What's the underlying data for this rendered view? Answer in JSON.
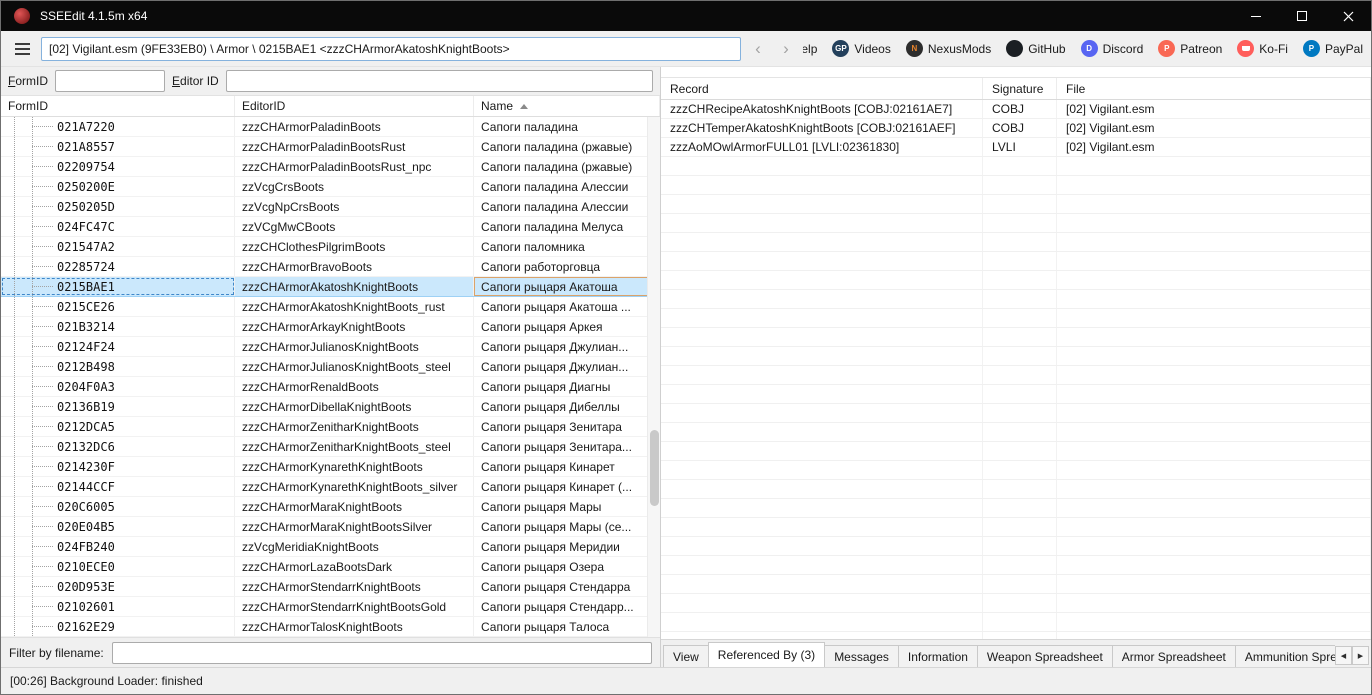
{
  "window": {
    "title": "SSEEdit 4.1.5m x64"
  },
  "toolbar": {
    "breadcrumb": "[02] Vigilant.esm (9FE33EB0) \\ Armor \\ 0215BAE1 <zzzCHArmorAkatoshKnightBoots>",
    "nav_back": "‹",
    "nav_forward": "›",
    "links": [
      {
        "label": "Help",
        "icon": "help-book-icon",
        "glyph": "book",
        "color": "#c89b5a"
      },
      {
        "label": "Videos",
        "icon": "videos-icon",
        "glyph": "GP",
        "color": "#23405c"
      },
      {
        "label": "NexusMods",
        "icon": "nexusmods-icon",
        "glyph": "N",
        "color": "#2d2d2d",
        "glyph_color": "#e6832c"
      },
      {
        "label": "GitHub",
        "icon": "github-icon",
        "glyph": "",
        "color": "#1b1f23"
      },
      {
        "label": "Discord",
        "icon": "discord-icon",
        "glyph": "D",
        "color": "#5865f2"
      },
      {
        "label": "Patreon",
        "icon": "patreon-icon",
        "glyph": "P",
        "color": "#f96854"
      },
      {
        "label": "Ko-Fi",
        "icon": "kofi-icon",
        "glyph": "cup",
        "color": "#ff5e5b"
      },
      {
        "label": "PayPal",
        "icon": "paypal-icon",
        "glyph": "P",
        "color": "#0079c1"
      }
    ]
  },
  "left_panel": {
    "formid_filter_label": "FormID",
    "formid_filter_value": "",
    "editorid_filter_label": "Editor ID",
    "editorid_filter_value": "",
    "columns": [
      "FormID",
      "EditorID",
      "Name"
    ],
    "sort_column": "Name",
    "filename_filter_label": "Filter by filename:",
    "filename_filter_value": "",
    "rows": [
      {
        "formid": "021A7220",
        "editorid": "zzzCHArmorPaladinBoots",
        "name": "Сапоги паладина",
        "selected": false
      },
      {
        "formid": "021A8557",
        "editorid": "zzzCHArmorPaladinBootsRust",
        "name": "Сапоги паладина (ржавые)",
        "selected": false
      },
      {
        "formid": "02209754",
        "editorid": "zzzCHArmorPaladinBootsRust_npc",
        "name": "Сапоги паладина (ржавые)",
        "selected": false
      },
      {
        "formid": "0250200E",
        "editorid": "zzVcgCrsBoots",
        "name": "Сапоги паладина Алессии",
        "selected": false
      },
      {
        "formid": "0250205D",
        "editorid": "zzVcgNpCrsBoots",
        "name": "Сапоги паладина Алессии",
        "selected": false
      },
      {
        "formid": "024FC47C",
        "editorid": "zzVCgMwCBoots",
        "name": "Сапоги паладина Мелуса",
        "selected": false
      },
      {
        "formid": "021547A2",
        "editorid": "zzzCHClothesPilgrimBoots",
        "name": "Сапоги паломника",
        "selected": false
      },
      {
        "formid": "02285724",
        "editorid": "zzzCHArmorBravoBoots",
        "name": "Сапоги работорговца",
        "selected": false
      },
      {
        "formid": "0215BAE1",
        "editorid": "zzzCHArmorAkatoshKnightBoots",
        "name": "Сапоги рыцаря Акатоша",
        "selected": true
      },
      {
        "formid": "0215CE26",
        "editorid": "zzzCHArmorAkatoshKnightBoots_rust",
        "name": "Сапоги рыцаря Акатоша ...",
        "selected": false
      },
      {
        "formid": "021B3214",
        "editorid": "zzzCHArmorArkayKnightBoots",
        "name": "Сапоги рыцаря Аркея",
        "selected": false
      },
      {
        "formid": "02124F24",
        "editorid": "zzzCHArmorJulianosKnightBoots",
        "name": "Сапоги рыцаря Джулиан...",
        "selected": false
      },
      {
        "formid": "0212B498",
        "editorid": "zzzCHArmorJulianosKnightBoots_steel",
        "name": "Сапоги рыцаря Джулиан...",
        "selected": false
      },
      {
        "formid": "0204F0A3",
        "editorid": "zzzCHArmorRenaldBoots",
        "name": "Сапоги рыцаря Диагны",
        "selected": false
      },
      {
        "formid": "02136B19",
        "editorid": "zzzCHArmorDibellaKnightBoots",
        "name": "Сапоги рыцаря Дибеллы",
        "selected": false
      },
      {
        "formid": "0212DCA5",
        "editorid": "zzzCHArmorZenitharKnightBoots",
        "name": "Сапоги рыцаря Зенитара",
        "selected": false
      },
      {
        "formid": "02132DC6",
        "editorid": "zzzCHArmorZenitharKnightBoots_steel",
        "name": "Сапоги рыцаря Зенитара...",
        "selected": false
      },
      {
        "formid": "0214230F",
        "editorid": "zzzCHArmorKynarethKnightBoots",
        "name": "Сапоги рыцаря Кинарет",
        "selected": false
      },
      {
        "formid": "02144CCF",
        "editorid": "zzzCHArmorKynarethKnightBoots_silver",
        "name": "Сапоги рыцаря Кинарет (...",
        "selected": false
      },
      {
        "formid": "020C6005",
        "editorid": "zzzCHArmorMaraKnightBoots",
        "name": "Сапоги рыцаря Мары",
        "selected": false
      },
      {
        "formid": "020E04B5",
        "editorid": "zzzCHArmorMaraKnightBootsSilver",
        "name": "Сапоги рыцаря Мары (се...",
        "selected": false
      },
      {
        "formid": "024FB240",
        "editorid": "zzVcgMeridiaKnightBoots",
        "name": "Сапоги рыцаря Меридии",
        "selected": false
      },
      {
        "formid": "0210ECE0",
        "editorid": "zzzCHArmorLazaBootsDark",
        "name": "Сапоги рыцаря Озера",
        "selected": false
      },
      {
        "formid": "020D953E",
        "editorid": "zzzCHArmorStendarrKnightBoots",
        "name": "Сапоги рыцаря Стендарра",
        "selected": false
      },
      {
        "formid": "02102601",
        "editorid": "zzzCHArmorStendarrKnightBootsGold",
        "name": "Сапоги рыцаря Стендарр...",
        "selected": false
      },
      {
        "formid": "02162E29",
        "editorid": "zzzCHArmorTalosKnightBoots",
        "name": "Сапоги рыцаря Талоса",
        "selected": false
      }
    ]
  },
  "right_panel": {
    "columns": [
      "Record",
      "Signature",
      "File"
    ],
    "rows": [
      {
        "record": "zzzCHRecipeAkatoshKnightBoots [COBJ:02161AE7]",
        "signature": "COBJ",
        "file": "[02] Vigilant.esm"
      },
      {
        "record": "zzzCHTemperAkatoshKnightBoots [COBJ:02161AEF]",
        "signature": "COBJ",
        "file": "[02] Vigilant.esm"
      },
      {
        "record": "zzzAoMOwlArmorFULL01 [LVLI:02361830]",
        "signature": "LVLI",
        "file": "[02] Vigilant.esm"
      }
    ],
    "tabs": [
      {
        "label": "View",
        "active": false
      },
      {
        "label": "Referenced By (3)",
        "active": true
      },
      {
        "label": "Messages",
        "active": false
      },
      {
        "label": "Information",
        "active": false
      },
      {
        "label": "Weapon Spreadsheet",
        "active": false
      },
      {
        "label": "Armor Spreadsheet",
        "active": false
      },
      {
        "label": "Ammunition Spreadsheet",
        "active": false
      }
    ]
  },
  "status_bar": {
    "text": "[00:26] Background Loader: finished"
  }
}
